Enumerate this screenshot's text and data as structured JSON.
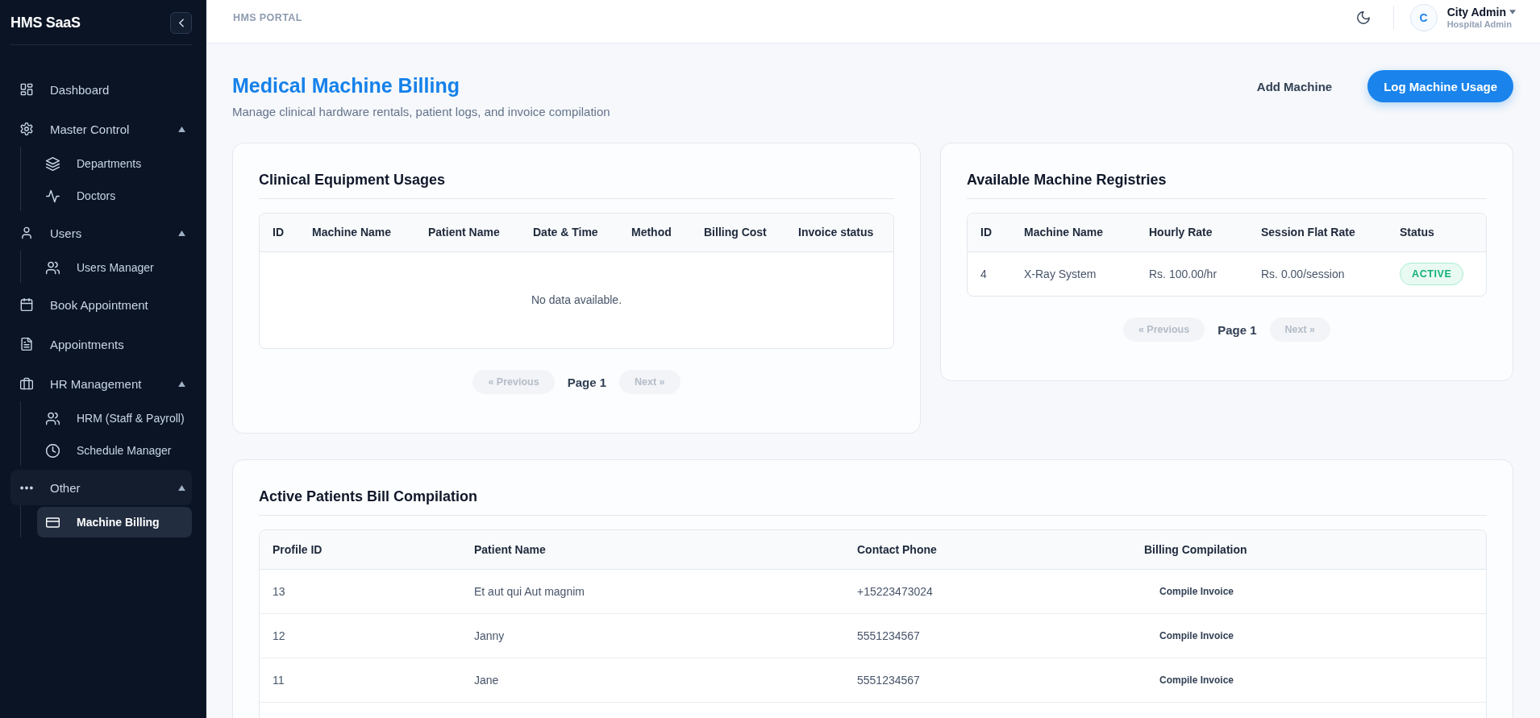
{
  "sidebar": {
    "brand": "HMS SaaS",
    "items": [
      {
        "label": "Dashboard",
        "selected": false
      },
      {
        "label": "Master Control",
        "selected": false,
        "expanded": true,
        "children": [
          {
            "label": "Departments",
            "selected": false
          },
          {
            "label": "Doctors",
            "selected": false
          }
        ]
      },
      {
        "label": "Users",
        "selected": false,
        "expanded": true,
        "children": [
          {
            "label": "Users Manager",
            "selected": false
          }
        ]
      },
      {
        "label": "Book Appointment",
        "selected": false
      },
      {
        "label": "Appointments",
        "selected": false
      },
      {
        "label": "HR Management",
        "selected": false,
        "expanded": true,
        "children": [
          {
            "label": "HRM (Staff & Payroll)",
            "selected": false
          },
          {
            "label": "Schedule Manager",
            "selected": false
          }
        ]
      },
      {
        "label": "Other",
        "selected": false,
        "expanded": true,
        "children": [
          {
            "label": "Machine Billing",
            "selected": true
          }
        ]
      }
    ]
  },
  "topbar": {
    "title": "HMS PORTAL",
    "user": {
      "initial": "C",
      "name": "City Admin",
      "role": "Hospital Admin"
    }
  },
  "page": {
    "title": "Medical Machine Billing",
    "subtitle": "Manage clinical hardware rentals, patient logs, and invoice compilation",
    "actions": [
      {
        "label": "Add Machine",
        "kind": "link"
      },
      {
        "label": "Log Machine Usage",
        "kind": "primary"
      }
    ]
  },
  "usages": {
    "title": "Clinical Equipment Usages",
    "columns": [
      "ID",
      "Machine Name",
      "Patient Name",
      "Date & Time",
      "Method",
      "Billing Cost",
      "Invoice status"
    ],
    "empty_message": "No data available.",
    "pagination": {
      "previous": {
        "label": "« Previous",
        "disabled": true
      },
      "page": "Page 1",
      "next": {
        "label": "Next »",
        "disabled": true
      }
    }
  },
  "registries": {
    "title": "Available Machine Registries",
    "columns": [
      "ID",
      "Machine Name",
      "Hourly Rate",
      "Session Flat Rate",
      "Status"
    ],
    "rows": [
      {
        "id": "4",
        "machine_name": "X-Ray System",
        "hourly_rate": "Rs. 100.00/hr",
        "session_flat_rate": "Rs. 0.00/session",
        "status": {
          "label": "ACTIVE",
          "active": true
        }
      }
    ],
    "pagination": {
      "previous": {
        "label": "« Previous",
        "disabled": true
      },
      "page": "Page 1",
      "next": {
        "label": "Next »",
        "disabled": true
      }
    }
  },
  "bills": {
    "title": "Active Patients Bill Compilation",
    "columns": [
      "Profile ID",
      "Patient Name",
      "Contact Phone",
      "Billing Compilation"
    ],
    "rows": [
      {
        "profile_id": "13",
        "patient_name": "Et aut qui Aut magnim",
        "contact_phone": "+15223473024",
        "action": "Compile Invoice"
      },
      {
        "profile_id": "12",
        "patient_name": "Janny",
        "contact_phone": "5551234567",
        "action": "Compile Invoice"
      },
      {
        "profile_id": "11",
        "patient_name": "Jane",
        "contact_phone": "5551234567",
        "action": "Compile Invoice"
      }
    ]
  }
}
